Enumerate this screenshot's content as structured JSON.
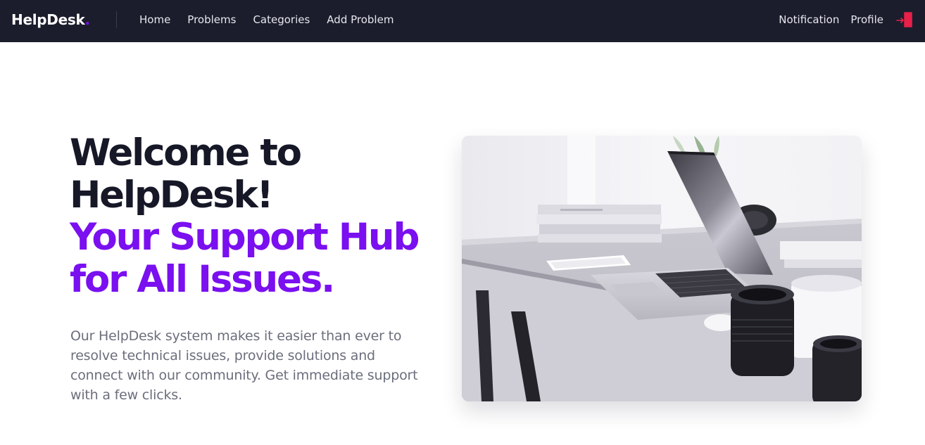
{
  "navbar": {
    "brand": "HelpDesk",
    "brand_dot": ".",
    "links": [
      "Home",
      "Problems",
      "Categories",
      "Add Problem"
    ],
    "right_links": [
      "Notification",
      "Profile"
    ],
    "logout_icon": "logout-icon"
  },
  "hero": {
    "heading_line1": "Welcome to",
    "heading_line2": "HelpDesk!",
    "accent_line1": "Your Support Hub",
    "accent_line2": "for All Issues.",
    "description": "Our HelpDesk system makes it easier than ever to resolve technical issues, provide solutions and connect with our community. Get immediate support with a few clicks.",
    "image_subject": "laptop-on-desk-photo"
  },
  "colors": {
    "navbar_bg": "#1b1d2c",
    "accent": "#7a0ff0",
    "heading": "#161827",
    "body_text": "#6b6e7c",
    "logout": "#e8204a"
  }
}
